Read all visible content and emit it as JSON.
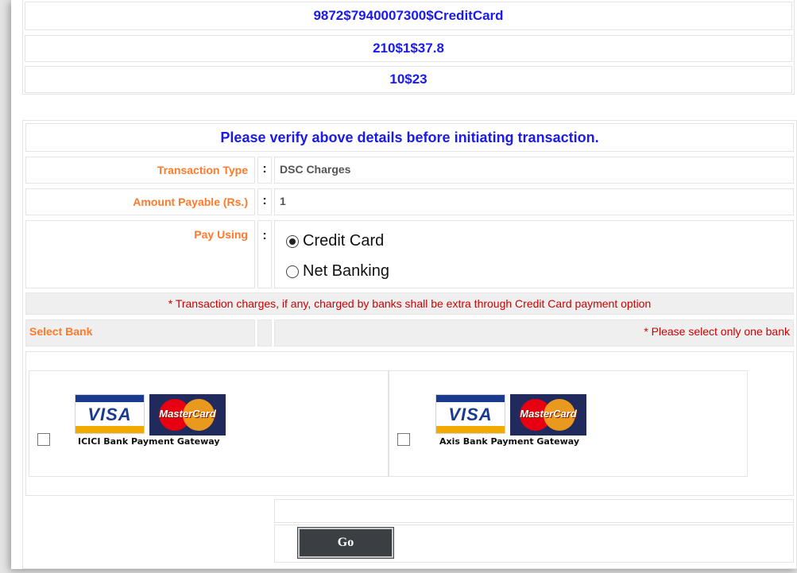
{
  "info": {
    "line1": "9872$7940007300$CreditCard",
    "line2": "210$1$37.8",
    "line3": "10$23"
  },
  "verify_message": "Please verify above details before initiating transaction.",
  "form": {
    "transaction_type_label": "Transaction Type",
    "transaction_type_value": "DSC Charges",
    "amount_label": "Amount Payable (Rs.)",
    "amount_value": "1",
    "pay_using_label": "Pay Using",
    "separator": ":",
    "pay_options": [
      {
        "label": "Credit Card",
        "selected": true
      },
      {
        "label": "Net Banking",
        "selected": false
      }
    ]
  },
  "charges_note": "* Transaction charges, if any, charged by banks shall be extra through Credit Card payment option",
  "select_bank_label": "Select Bank",
  "select_bank_note": "* Please select only one bank",
  "banks": [
    {
      "visa_text": "VISA",
      "mastercard_text": "MasterCard",
      "gateway": "ICICI Bank Payment Gateway",
      "checked": false
    },
    {
      "visa_text": "VISA",
      "mastercard_text": "MasterCard",
      "gateway": "Axis Bank Payment Gateway",
      "checked": false
    }
  ],
  "go_button": "Go",
  "colors": {
    "info_text": "#1a1aee",
    "label_text": "#ff7a2b",
    "note_text": "#cc0000",
    "button_bg": "#3b3e42"
  }
}
